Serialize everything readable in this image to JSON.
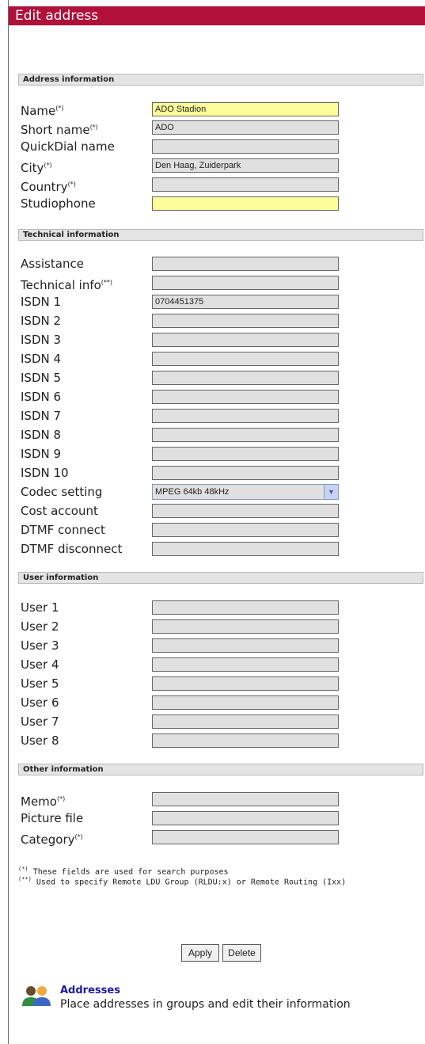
{
  "window_title": "Edit address",
  "sections": {
    "address": "Address information",
    "technical": "Technical information",
    "user": "User information",
    "other": "Other information"
  },
  "address": {
    "name": {
      "label": "Name",
      "mark": "(*)",
      "value": "ADO Stadion"
    },
    "short_name": {
      "label": "Short name",
      "mark": "(*)",
      "value": "ADO"
    },
    "quickdial": {
      "label": "QuickDial name",
      "value": ""
    },
    "city": {
      "label": "City",
      "mark": "(*)",
      "value": "Den Haag, Zuiderpark"
    },
    "country": {
      "label": "Country",
      "mark": "(*)",
      "value": ""
    },
    "studiophone": {
      "label": "Studiophone",
      "value": ""
    }
  },
  "technical": {
    "assistance": {
      "label": "Assistance",
      "value": ""
    },
    "technical_info": {
      "label": "Technical info",
      "mark": "(**)",
      "value": ""
    },
    "isdn": [
      {
        "label": "ISDN 1",
        "value": "0704451375"
      },
      {
        "label": "ISDN 2",
        "value": ""
      },
      {
        "label": "ISDN 3",
        "value": ""
      },
      {
        "label": "ISDN 4",
        "value": ""
      },
      {
        "label": "ISDN 5",
        "value": ""
      },
      {
        "label": "ISDN 6",
        "value": ""
      },
      {
        "label": "ISDN 7",
        "value": ""
      },
      {
        "label": "ISDN 8",
        "value": ""
      },
      {
        "label": "ISDN 9",
        "value": ""
      },
      {
        "label": "ISDN 10",
        "value": ""
      }
    ],
    "codec": {
      "label": "Codec setting",
      "value": "MPEG 64kb 48kHz"
    },
    "cost_account": {
      "label": "Cost account",
      "value": ""
    },
    "dtmf_connect": {
      "label": "DTMF connect",
      "value": ""
    },
    "dtmf_disconnect": {
      "label": "DTMF disconnect",
      "value": ""
    }
  },
  "users": [
    {
      "label": "User 1",
      "value": ""
    },
    {
      "label": "User 2",
      "value": ""
    },
    {
      "label": "User 3",
      "value": ""
    },
    {
      "label": "User 4",
      "value": ""
    },
    {
      "label": "User 5",
      "value": ""
    },
    {
      "label": "User 6",
      "value": ""
    },
    {
      "label": "User 7",
      "value": ""
    },
    {
      "label": "User 8",
      "value": ""
    }
  ],
  "other": {
    "memo": {
      "label": "Memo",
      "mark": "(*)",
      "value": ""
    },
    "picture": {
      "label": "Picture file",
      "value": ""
    },
    "category": {
      "label": "Category",
      "mark": "(*)",
      "value": ""
    }
  },
  "notes": {
    "n1_mark": "(*)",
    "n1_text": "These fields are used for search purposes",
    "n2_mark": "(**)",
    "n2_text": "Used to specify Remote LDU Group (RLDU:x) or Remote Routing (Ixx)"
  },
  "buttons": {
    "apply": "Apply",
    "delete": "Delete"
  },
  "footer": {
    "icon": "users-group-icon",
    "title": "Addresses",
    "description": "Place addresses in groups and edit their information"
  },
  "colors": {
    "title_bar": "#b0103a",
    "required_field": "#fdfd99",
    "field": "#e0e0e0",
    "link": "#1a1aa6"
  }
}
